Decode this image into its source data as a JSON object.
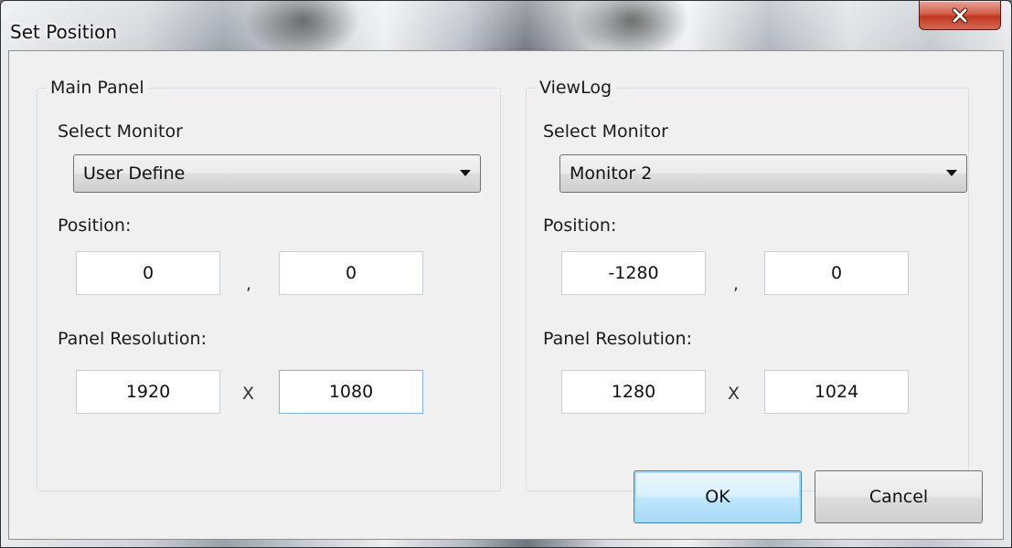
{
  "window": {
    "title": "Set Position"
  },
  "main_panel": {
    "group_title": "Main Panel",
    "select_monitor_label": "Select Monitor",
    "monitor_selected": "User Define",
    "position_label": "Position:",
    "position_x": "0",
    "position_separator": ",",
    "position_y": "0",
    "resolution_label": "Panel Resolution:",
    "resolution_width": "1920",
    "resolution_separator": "X",
    "resolution_height": "1080"
  },
  "viewlog": {
    "group_title": "ViewLog",
    "select_monitor_label": "Select Monitor",
    "monitor_selected": "Monitor 2",
    "position_label": "Position:",
    "position_x": "-1280",
    "position_separator": ",",
    "position_y": "0",
    "resolution_label": "Panel Resolution:",
    "resolution_width": "1280",
    "resolution_separator": "X",
    "resolution_height": "1024"
  },
  "buttons": {
    "ok_label": "OK",
    "cancel_label": "Cancel"
  },
  "icons": {
    "close": "close-icon",
    "dropdown": "chevron-down-icon"
  },
  "colors": {
    "close_button": "#c1371f",
    "default_button_border": "#3c7fb1",
    "dialog_background": "#f0f0f0"
  }
}
